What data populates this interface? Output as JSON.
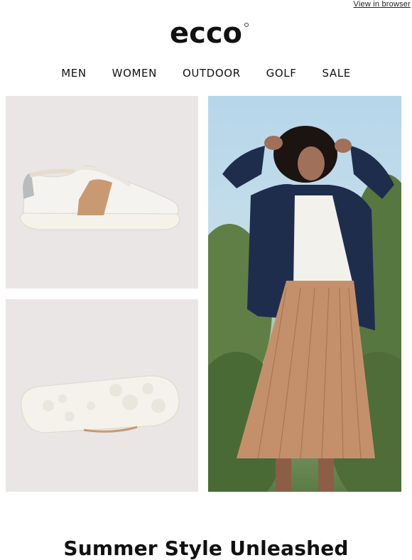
{
  "header": {
    "view_in_browser": "View in browser"
  },
  "brand": {
    "name": "ecco"
  },
  "nav": {
    "items": [
      "MEN",
      "WOMEN",
      "OUTDOOR",
      "GOLF",
      "SALE"
    ]
  },
  "images": {
    "sneaker_side": "white sneaker side view with metallic rose gold stripe",
    "sneaker_sole": "white sneaker sole view",
    "model": "woman in navy jacket and pleated tan skirt outdoors"
  },
  "headline": "Summer Style Unleashed",
  "colors": {
    "tile_bg": "#eae6e6",
    "accent_gold": "#c99a72",
    "navy": "#1f2d4d"
  }
}
